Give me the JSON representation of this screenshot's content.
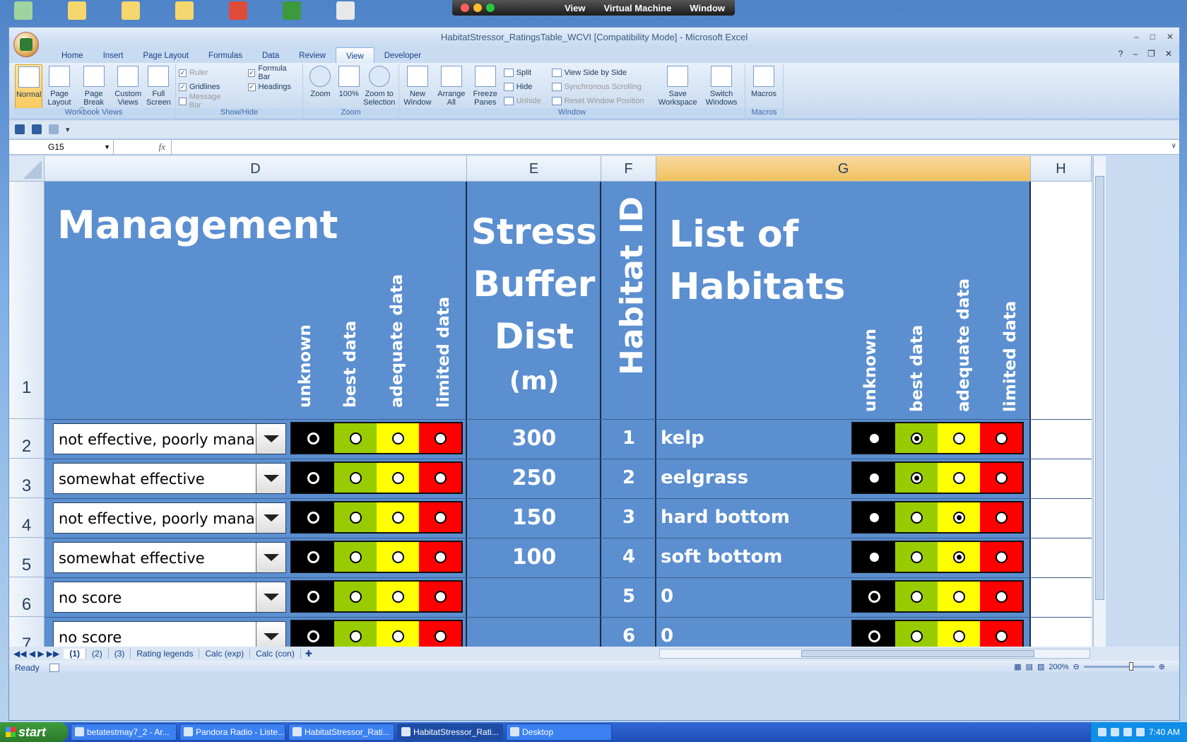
{
  "desktop": {
    "icons": [
      "recycle-bin-icon",
      "folder-icon",
      "folder-icon",
      "folder-icon",
      "pdf-icon",
      "excel-file-icon",
      "app-icon"
    ]
  },
  "vm_bar": {
    "menu": [
      "View",
      "Virtual Machine",
      "Window"
    ]
  },
  "window": {
    "title": "HabitatStressor_RatingsTable_WCVI  [Compatibility Mode] - Microsoft Excel"
  },
  "tabs": [
    "Home",
    "Insert",
    "Page Layout",
    "Formulas",
    "Data",
    "Review",
    "View",
    "Developer"
  ],
  "active_tab": "View",
  "ribbon": {
    "workbook_views": {
      "title": "Workbook Views",
      "buttons": [
        "Normal",
        "Page Layout",
        "Page Break Preview",
        "Custom Views",
        "Full Screen"
      ]
    },
    "show_hide": {
      "title": "Show/Hide",
      "ruler": "Ruler",
      "gridlines": "Gridlines",
      "message_bar": "Message Bar",
      "formula_bar": "Formula Bar",
      "headings": "Headings"
    },
    "zoom": {
      "title": "Zoom",
      "buttons": [
        "Zoom",
        "100%",
        "Zoom to Selection"
      ]
    },
    "window": {
      "title": "Window",
      "buttons": [
        "New Window",
        "Arrange All",
        "Freeze Panes"
      ],
      "split": "Split",
      "hide": "Hide",
      "unhide": "Unhide",
      "side_by_side": "View Side by Side",
      "sync_scroll": "Synchronous Scrolling",
      "reset_pos": "Reset Window Position",
      "save_ws": "Save Workspace",
      "switch": "Switch Windows"
    },
    "macros": {
      "title": "Macros",
      "button": "Macros"
    }
  },
  "formula_bar": {
    "name_box": "G15",
    "fx": "fx",
    "value": ""
  },
  "columns": [
    "D",
    "E",
    "F",
    "G",
    "H"
  ],
  "selected_column": "G",
  "rows": [
    "1",
    "2",
    "3",
    "4",
    "5",
    "6",
    "7"
  ],
  "header": {
    "management": "Management",
    "stress_buffer": [
      "Stress",
      "Buffer",
      "Dist"
    ],
    "unit": "(m)",
    "habitat_id": "Habitat ID",
    "habitats": [
      "List of",
      "Habitats"
    ],
    "quality_labels": [
      "unknown",
      "best data",
      "adequate data",
      "limited data"
    ]
  },
  "data_rows": [
    {
      "management": "not effective, poorly managed",
      "mgmt_selected": 0,
      "buffer": "300",
      "id": "1",
      "habitat": "kelp",
      "hab_selected": 1
    },
    {
      "management": "somewhat effective",
      "mgmt_selected": 0,
      "buffer": "250",
      "id": "2",
      "habitat": "eelgrass",
      "hab_selected": 1
    },
    {
      "management": "not effective, poorly managed",
      "mgmt_selected": 0,
      "buffer": "150",
      "id": "3",
      "habitat": "hard bottom",
      "hab_selected": 2
    },
    {
      "management": "somewhat effective",
      "mgmt_selected": 0,
      "buffer": "100",
      "id": "4",
      "habitat": "soft bottom",
      "hab_selected": 2
    },
    {
      "management": "no score",
      "mgmt_selected": 0,
      "buffer": "",
      "id": "5",
      "habitat": "0",
      "hab_selected": 0
    },
    {
      "management": "no score",
      "mgmt_selected": 0,
      "buffer": "",
      "id": "6",
      "habitat": "0",
      "hab_selected": 0
    }
  ],
  "sheet_tabs": [
    "(1)",
    "(2)",
    "(3)",
    "Rating legends",
    "Calc (exp)",
    "Calc (con)"
  ],
  "status": {
    "ready": "Ready",
    "zoom": "200%"
  },
  "taskbar": {
    "start": "start",
    "tasks": [
      "betatestmay7_2 - Ar...",
      "Pandora Radio - Liste...",
      "HabitatStressor_Rati...",
      "HabitatStressor_Rati...",
      "Desktop"
    ],
    "clock": "7:40 AM"
  },
  "colors": {
    "cell_bg": "#5b8fd0",
    "black": "#000000",
    "green": "#99cc00",
    "yellow": "#ffff00",
    "red": "#ff0000"
  }
}
